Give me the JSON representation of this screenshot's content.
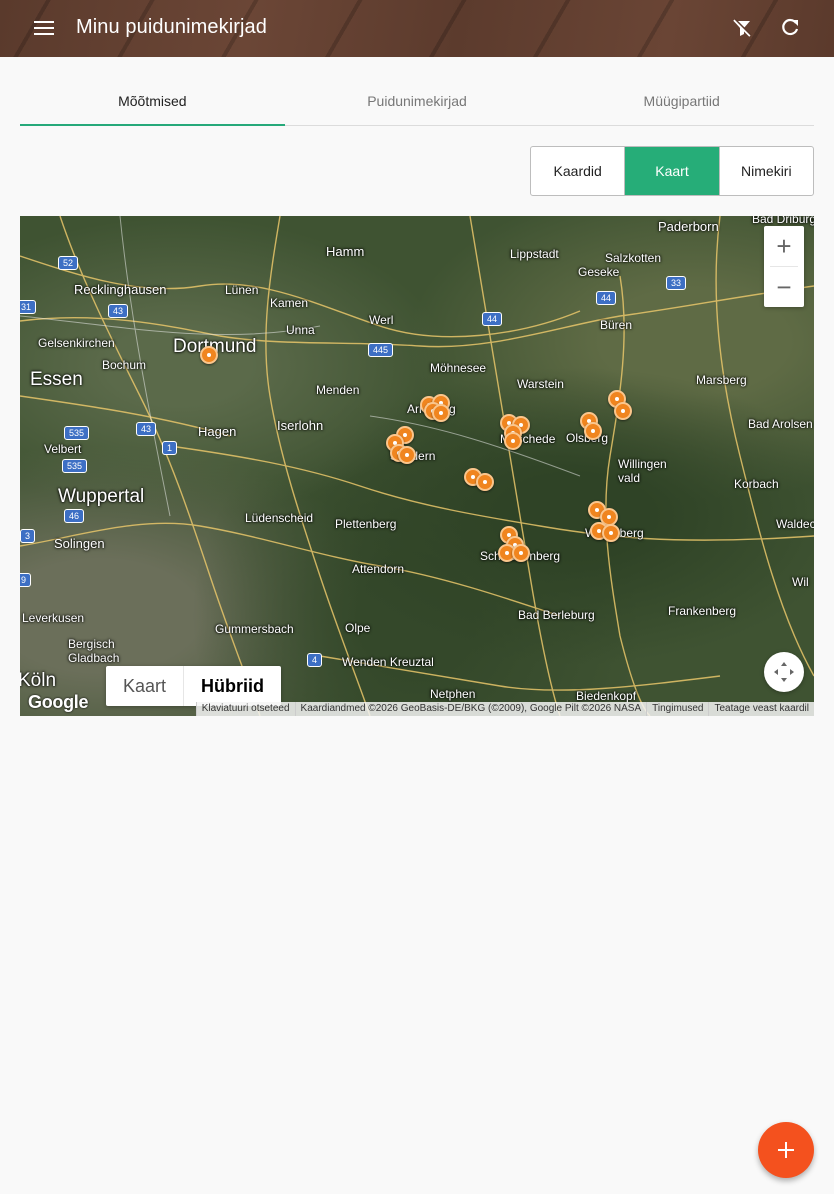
{
  "appbar": {
    "title": "Minu puidunimekirjad",
    "menu_icon": "menu-icon",
    "filter_icon": "filter-off-icon",
    "refresh_icon": "refresh-icon"
  },
  "tabs": [
    {
      "label": "Mõõtmised",
      "active": true
    },
    {
      "label": "Puidunimekirjad",
      "active": false
    },
    {
      "label": "Müügipartiid",
      "active": false
    }
  ],
  "view_toggle": [
    {
      "label": "Kaardid",
      "active": false
    },
    {
      "label": "Kaart",
      "active": true
    },
    {
      "label": "Nimekiri",
      "active": false
    }
  ],
  "map": {
    "places": {
      "dortmund": "Dortmund",
      "essen": "Essen",
      "wuppertal": "Wuppertal",
      "hamm": "Hamm",
      "lippstadt": "Lippstadt",
      "paderborn": "Paderborn",
      "salzkotten": "Salzkotten",
      "geseke": "Geseke",
      "recklinghausen": "Recklinghausen",
      "lunen": "Lünen",
      "kamen": "Kamen",
      "unna": "Unna",
      "werl": "Werl",
      "buren": "Büren",
      "gelsenkirchen": "Gelsenkirchen",
      "bochum": "Bochum",
      "mohnesee": "Möhnesee",
      "warstein": "Warstein",
      "marsberg": "Marsberg",
      "menden": "Menden",
      "arnsberg": "Arnsberg",
      "hagen": "Hagen",
      "iserlohn": "Iserlohn",
      "velbert": "Velbert",
      "meschede": "Meschede",
      "olsberg": "Olsberg",
      "bad_arolsen": "Bad Arolsen",
      "willingen": "Willingen\nvald",
      "korbach": "Korbach",
      "sundern": "Sundern",
      "ludenscheid": "Lüdenscheid",
      "plettenberg": "Plettenberg",
      "solingen": "Solingen",
      "winterberg": "Winterberg",
      "waldeck": "Waldec",
      "attendorn": "Attendorn",
      "schmallenberg": "Schmallenberg",
      "leverkusen": "Leverkusen",
      "bad_berleburg": "Bad Berleburg",
      "frankenberg": "Frankenberg",
      "bergisch": "Bergisch\nGladbach",
      "gummersbach": "Gummersbach",
      "olpe": "Olpe",
      "wenden": "Wenden Kreuztal",
      "koln": "Köln",
      "netphen": "Netphen",
      "biedenkopf": "Biedenkopf",
      "bad_driburg": "Bad Driburg",
      "wil": "Wil"
    },
    "road_shields": [
      "52",
      "43",
      "31",
      "44",
      "445",
      "33",
      "44",
      "43",
      "1",
      "535",
      "46",
      "3",
      "9",
      "4"
    ],
    "zoom_in": "+",
    "zoom_out": "−",
    "map_type": [
      {
        "label": "Kaart",
        "active": false
      },
      {
        "label": "Hübriid",
        "active": true
      }
    ],
    "google_logo": "Google",
    "attribution": [
      "Klaviatuuri otseteed",
      "Kaardiandmed ©2026 GeoBasis-DE/BKG (©2009), Google Pilt ©2026 NASA",
      "Tingimused",
      "Teatage veast kaardil"
    ],
    "marker_count": 31
  },
  "fab": {
    "icon": "plus-icon",
    "label": "+"
  }
}
